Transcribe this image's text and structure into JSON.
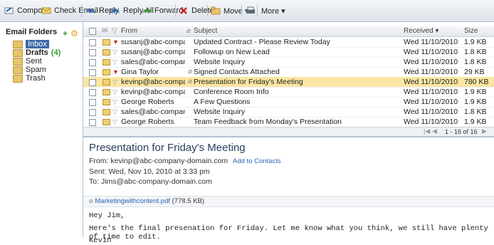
{
  "toolbar": {
    "compose": "Compose",
    "check_email": "Check Email",
    "reply": "Reply",
    "reply_all": "Reply All",
    "forward": "Forward",
    "delete": "Delete",
    "move": "Move ▾",
    "more": "More ▾"
  },
  "sidebar": {
    "title": "Email Folders",
    "folders": [
      {
        "label": "Inbox",
        "count": ""
      },
      {
        "label": "Drafts",
        "count": "(4)"
      },
      {
        "label": "Sent",
        "count": ""
      },
      {
        "label": "Spam",
        "count": ""
      },
      {
        "label": "Trash",
        "count": ""
      }
    ]
  },
  "table": {
    "headers": {
      "from": "From",
      "subject": "Subject",
      "received": "Received ▾",
      "size": "Size"
    },
    "rows": [
      {
        "from": "susanj@abc-company-doma",
        "subject": "Updated Contract - Please Review Today",
        "received": "Wed 11/10/2010",
        "size": "1.9 KB",
        "flag": "red"
      },
      {
        "from": "susanj@abc-company-doma",
        "subject": "Followup on New Lead",
        "received": "Wed 11/10/2010",
        "size": "1.8 KB",
        "flag": "none"
      },
      {
        "from": "sales@abc-company-domain",
        "subject": "Website Inquiry",
        "received": "Wed 11/10/2010",
        "size": "1.8 KB",
        "flag": "none"
      },
      {
        "from": "Gina Taylor",
        "subject": "Signed Contacts Attached",
        "received": "Wed 11/10/2010",
        "size": "29 KB",
        "flag": "red"
      },
      {
        "from": "kevinp@abc-company-doma",
        "subject": "Presentation for Friday's Meeting",
        "received": "Wed 11/10/2010",
        "size": "780 KB",
        "flag": "none"
      },
      {
        "from": "kevinp@abc-company-doma",
        "subject": "Conference Room Info",
        "received": "Wed 11/10/2010",
        "size": "1.9 KB",
        "flag": "none"
      },
      {
        "from": "George Roberts",
        "subject": "A Few Questions",
        "received": "Wed 11/10/2010",
        "size": "1.9 KB",
        "flag": "none"
      },
      {
        "from": "sales@abc-company-domain",
        "subject": "Website Inquiry",
        "received": "Wed 11/10/2010",
        "size": "1.8 KB",
        "flag": "none"
      },
      {
        "from": "George Roberts",
        "subject": "Team Feedback from Monday's Presentation",
        "received": "Wed 11/10/2010",
        "size": "1.9 KB",
        "flag": "none"
      }
    ],
    "pager": "1 - 16 of 16"
  },
  "preview": {
    "subject": "Presentation for Friday's Meeting",
    "from_label": "From:",
    "from": "kevinp@abc-company-domain.com",
    "add_contacts": "Add to Contacts",
    "sent_label": "Sent:",
    "sent": "Wed, Nov 10, 2010 at 3:33 pm",
    "to_label": "To:",
    "to": "Jims@abc-company-domain.com",
    "attachment": "Marketingwithcontent.pdf",
    "attachment_size": "(778.5 KB)",
    "greeting": "Hey Jim,",
    "body": "Here's the final presenation for Friday. Let me know what you think, we still have plenty of time to edit.",
    "signature": "Kevin"
  },
  "colors": {
    "selected_row": "#fbe6a3",
    "flag_red": "#cc2222",
    "accent": "#3d6aa8"
  }
}
